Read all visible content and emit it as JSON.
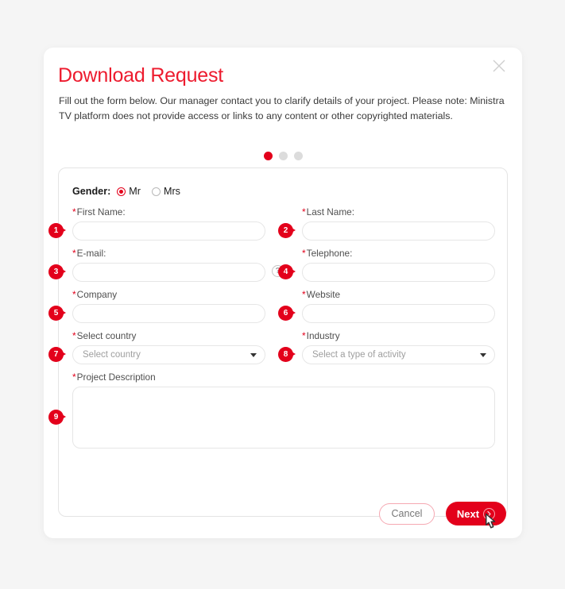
{
  "modal": {
    "title": "Download Request",
    "subtitle": "Fill out the form below. Our manager contact you to clarify details of your project. Please note: Ministra TV platform does not provide access or links to any content or other copyrighted materials.",
    "close_icon": "close-icon"
  },
  "steps": {
    "total": 3,
    "active_index": 0
  },
  "gender": {
    "label": "Gender:",
    "options": [
      {
        "label": "Mr",
        "selected": true
      },
      {
        "label": "Mrs",
        "selected": false
      }
    ]
  },
  "fields": {
    "first_name": {
      "label": "First Name:",
      "required": true,
      "value": "",
      "placeholder": "",
      "badge": "1"
    },
    "last_name": {
      "label": "Last Name:",
      "required": true,
      "value": "",
      "placeholder": "",
      "badge": "2"
    },
    "email": {
      "label": "E-mail:",
      "required": true,
      "value": "",
      "placeholder": "",
      "badge": "3",
      "help": "?"
    },
    "telephone": {
      "label": "Telephone:",
      "required": true,
      "value": "",
      "placeholder": "",
      "badge": "4"
    },
    "company": {
      "label": "Company",
      "required": true,
      "value": "",
      "placeholder": "",
      "badge": "5"
    },
    "website": {
      "label": "Website",
      "required": true,
      "value": "",
      "placeholder": "",
      "badge": "6"
    },
    "country": {
      "label": "Select country",
      "required": true,
      "value": "",
      "placeholder": "Select country",
      "badge": "7"
    },
    "industry": {
      "label": "Industry",
      "required": true,
      "value": "",
      "placeholder": "Select a type of activity",
      "badge": "8"
    },
    "description": {
      "label": "Project Description",
      "required": true,
      "value": "",
      "placeholder": "",
      "badge": "9"
    }
  },
  "required_marker": "*",
  "buttons": {
    "cancel": "Cancel",
    "next": "Next",
    "next_icon": "chevron-right-icon"
  },
  "colors": {
    "accent_red": "#e3001b",
    "title_red": "#ed1b2e",
    "dot_inactive": "#dcdcdc",
    "border": "#e6e6e6",
    "page_bg": "#f5f5f5"
  }
}
